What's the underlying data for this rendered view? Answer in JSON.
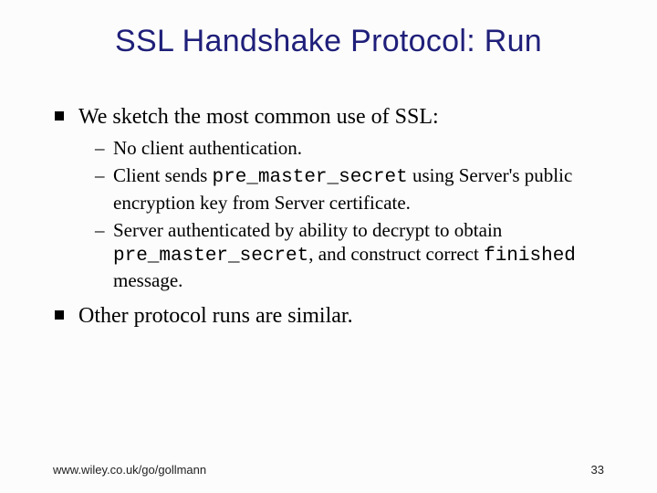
{
  "title": "SSL Handshake Protocol: Run",
  "bullets": {
    "b1_text": "We sketch the most common use of SSL:",
    "b1_sub1": "No client authentication.",
    "b1_sub2_a": "Client sends ",
    "b1_sub2_code": "pre_master_secret",
    "b1_sub2_b": " using Server's public encryption key from Server certificate.",
    "b1_sub3_a": "Server authenticated by ability to decrypt to obtain ",
    "b1_sub3_code1": "pre_master_secret",
    "b1_sub3_b": ", and construct correct ",
    "b1_sub3_code2": "finished",
    "b1_sub3_c": " message.",
    "b2_text": "Other protocol runs are similar."
  },
  "footer": {
    "url": "www.wiley.co.uk/go/gollmann",
    "page": "33"
  }
}
